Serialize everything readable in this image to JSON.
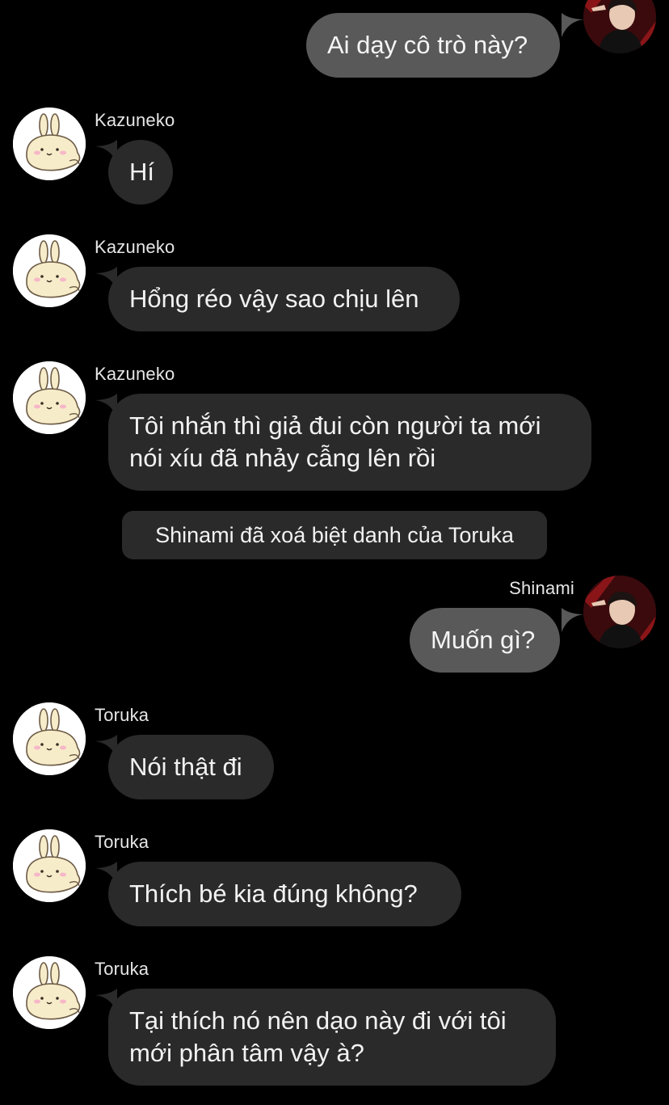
{
  "messages": [
    {
      "sender": "",
      "text": "Ai dạy cô trò này?"
    },
    {
      "sender": "Kazuneko",
      "text": "Hí"
    },
    {
      "sender": "Kazuneko",
      "text": "Hổng réo vậy sao chịu lên"
    },
    {
      "sender": "Kazuneko",
      "text": "Tôi nhắn thì giả đui còn người ta mới nói xíu đã nhảy cẫng lên rồi"
    },
    {
      "sender": "Shinami",
      "text": "Muốn gì?"
    },
    {
      "sender": "Toruka",
      "text": "Nói thật đi"
    },
    {
      "sender": "Toruka",
      "text": "Thích bé kia đúng không?"
    },
    {
      "sender": "Toruka",
      "text": "Tại thích nó nên dạo này đi với tôi mới phân tâm vậy à?"
    }
  ],
  "system_notice": "Shinami đã xoá biệt danh của Toruka",
  "colors": {
    "background": "#000000",
    "incoming_bubble": "#2a2a2a",
    "outgoing_bubble": "#595959"
  }
}
